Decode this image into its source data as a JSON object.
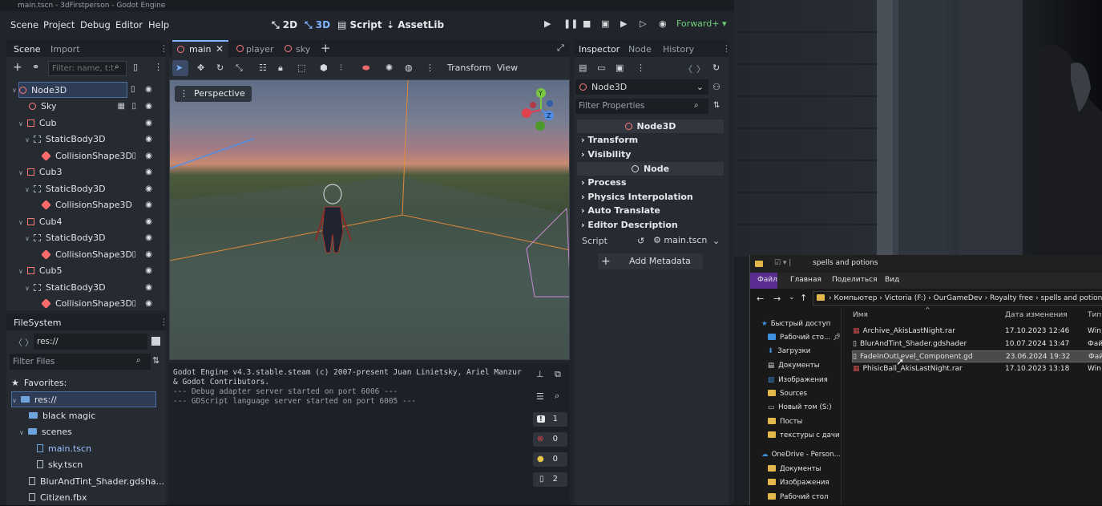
{
  "window_title": "main.tscn - 3dFirstperson - Godot Engine",
  "menus": [
    "Scene",
    "Project",
    "Debug",
    "Editor",
    "Help"
  ],
  "modes": {
    "m2d": "2D",
    "m3d": "3D",
    "script": "Script",
    "assetlib": "AssetLib"
  },
  "renderer": "Forward+",
  "scene_tabs": {
    "scene": "Scene",
    "import": "Import",
    "filter_placeholder": "Filter: name, t:t"
  },
  "scene_tree": [
    {
      "label": "Node3D",
      "icon": "node3d-icon"
    },
    {
      "label": "Sky",
      "icon": "node3d-icon"
    },
    {
      "label": "Cub",
      "icon": "mesh-icon"
    },
    {
      "label": "StaticBody3D",
      "icon": "body-icon"
    },
    {
      "label": "CollisionShape3D",
      "icon": "shape-icon"
    },
    {
      "label": "Cub3",
      "icon": "mesh-icon"
    },
    {
      "label": "StaticBody3D",
      "icon": "body-icon"
    },
    {
      "label": "CollisionShape3D",
      "icon": "shape-icon"
    },
    {
      "label": "Cub4",
      "icon": "mesh-icon"
    },
    {
      "label": "StaticBody3D",
      "icon": "body-icon"
    },
    {
      "label": "CollisionShape3D",
      "icon": "shape-icon"
    },
    {
      "label": "Cub5",
      "icon": "mesh-icon"
    },
    {
      "label": "StaticBody3D",
      "icon": "body-icon"
    },
    {
      "label": "CollisionShape3D",
      "icon": "shape-icon"
    }
  ],
  "filesystem": {
    "title": "FileSystem",
    "path": "res://",
    "filter_placeholder": "Filter Files",
    "favorites": "Favorites:",
    "items": [
      "res://",
      "black magic",
      "scenes",
      "main.tscn",
      "sky.tscn",
      "BlurAndTint_Shader.gdsha...",
      "Citizen.fbx"
    ]
  },
  "editor_tabs": [
    "main",
    "player",
    "sky"
  ],
  "viewport": {
    "perspective": "Perspective",
    "transform": "Transform",
    "view": "View"
  },
  "console": {
    "lines": [
      "Godot Engine v4.3.stable.steam (c) 2007-present Juan Linietsky, Ariel Manzur",
      "& Godot Contributors.",
      "--- Debug adapter server started on port 6006 ---",
      "--- GDScript language server started on port 6005 ---"
    ],
    "counts": [
      "1",
      "0",
      "0",
      "2"
    ]
  },
  "inspector": {
    "tabs": [
      "Inspector",
      "Node",
      "History"
    ],
    "node": "Node3D",
    "filter_placeholder": "Filter Properties",
    "header_node3d": "Node3D",
    "sections1": [
      "Transform",
      "Visibility"
    ],
    "header_node": "Node",
    "sections2": [
      "Process",
      "Physics Interpolation",
      "Auto Translate",
      "Editor Description"
    ],
    "script_label": "Script",
    "script_value": "main.tscn",
    "add_metadata": "Add Metadata"
  },
  "explorer": {
    "title": "spells and potions",
    "ribbon": [
      "Файл",
      "Главная",
      "Поделиться",
      "Вид"
    ],
    "breadcrumb": [
      "Компьютер",
      "Victoria (F:)",
      "OurGameDev",
      "Royalty free",
      "spells and potions"
    ],
    "columns": {
      "name": "Имя",
      "date": "Дата изменения",
      "type": "Тип"
    },
    "files": [
      {
        "name": "Archive_AkisLastNight.rar",
        "date": "17.10.2023 12:46",
        "type": "Win"
      },
      {
        "name": "BlurAndTint_Shader.gdshader",
        "date": "10.07.2024 13:47",
        "type": "Фай"
      },
      {
        "name": "FadeInOutLevel_Component.gd",
        "date": "23.06.2024 19:32",
        "type": "Фай"
      },
      {
        "name": "PhisicBall_AkisLastNight.rar",
        "date": "17.10.2023 13:18",
        "type": "Win"
      }
    ],
    "sidebar": [
      "Быстрый доступ",
      "Рабочий сто...",
      "Загрузки",
      "Документы",
      "Изображения",
      "Sources",
      "Новый том (S:)",
      "Посты",
      "текстуры с дачи",
      "OneDrive - Person...",
      "Документы",
      "Изображения",
      "Рабочий стол"
    ]
  }
}
